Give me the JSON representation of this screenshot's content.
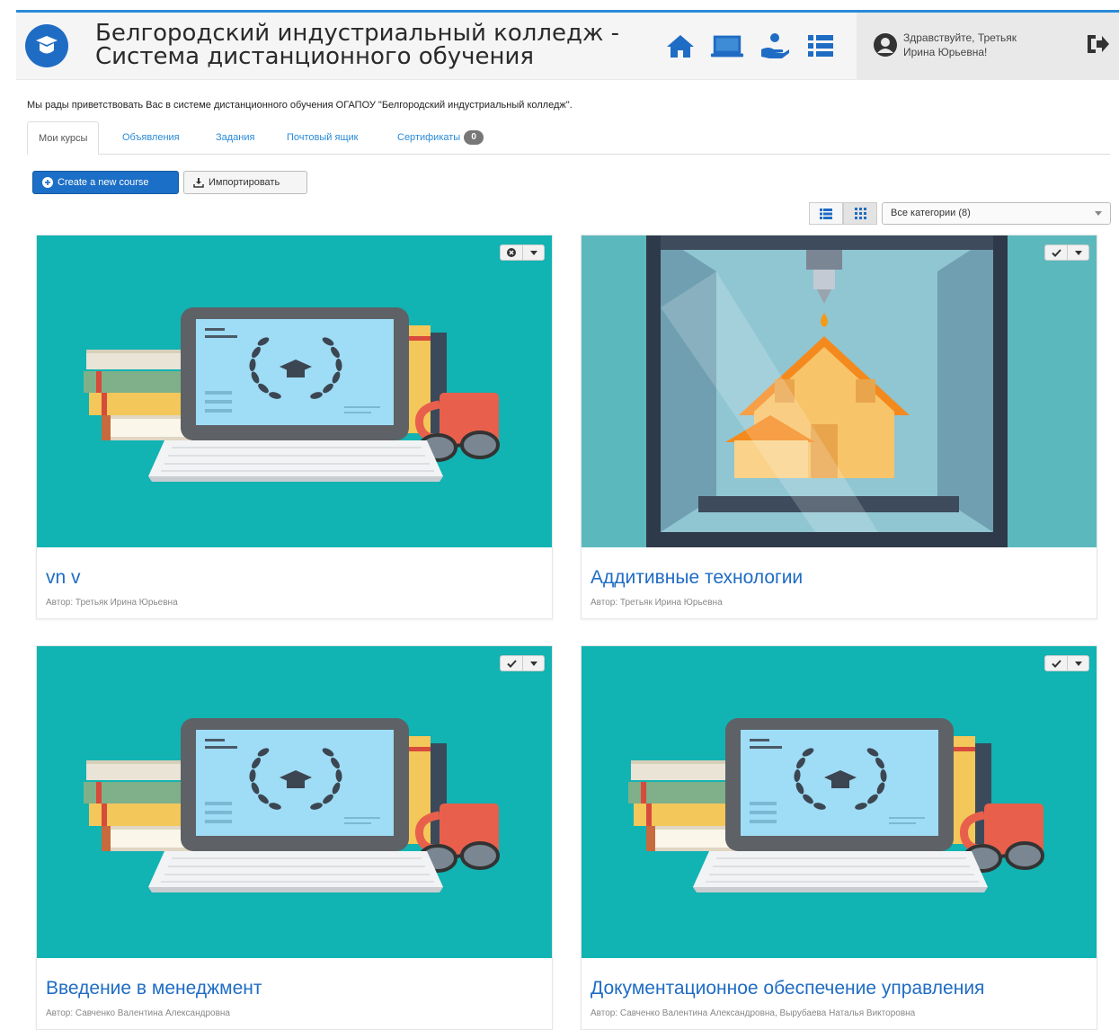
{
  "header": {
    "title_line1": "Белгородский индустриальный колледж -",
    "title_line2": "Система дистанционного обучения",
    "greeting_line1": "Здравствуйте, Третьяк",
    "greeting_line2": "Ирина Юрьевна!"
  },
  "nav_icons": [
    "home-icon",
    "monitor-icon",
    "hand-coin-icon",
    "list-icon"
  ],
  "welcome": "Мы рады приветствовать Вас в системе дистанционного обучения ОГАПОУ \"Белгородский индустриальный колледж\".",
  "tabs": {
    "my_courses": "Мои курсы",
    "announcements": "Объявления",
    "tasks": "Задания",
    "mailbox": "Почтовый ящик",
    "certificates": "Сертификаты",
    "certificates_count": "0"
  },
  "toolbar": {
    "create_course": "Create a new course",
    "import": "Импортировать"
  },
  "filter": {
    "category": "Все категории (8)"
  },
  "courses": [
    {
      "title": "vn v",
      "author": "Автор: Третьяк Ирина Юрьевна",
      "status_icon": "x-circle-icon"
    },
    {
      "title": "Аддитивные технологии",
      "author": "Автор: Третьяк Ирина Юрьевна",
      "status_icon": "check-icon"
    },
    {
      "title": "Введение в менеджмент",
      "author": "Автор: Савченко Валентина Александровна",
      "status_icon": "check-icon"
    },
    {
      "title": "Документационное обеспечение управления",
      "author": "Автор: Савченко Валентина Александровна, Вырубаева Наталья Викторовна",
      "status_icon": "check-icon"
    }
  ],
  "colors": {
    "accent": "#1f6cc4",
    "card_teal": "#11b3b3",
    "printer_teal": "#5bb9bd"
  }
}
